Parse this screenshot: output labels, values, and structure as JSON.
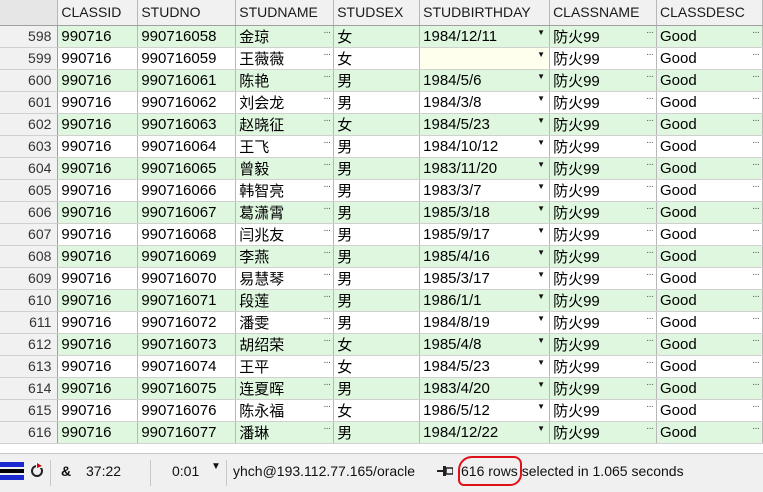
{
  "columns": [
    "CLASSID",
    "STUDNO",
    "STUDNAME",
    "STUDSEX",
    "STUDBIRTHDAY",
    "CLASSNAME",
    "CLASSDESC"
  ],
  "rows": [
    {
      "num": "598",
      "classid": "990716",
      "studno": "990716058",
      "name": "金琼",
      "sex": "女",
      "birthday": "1984/12/11",
      "classname": "防火99",
      "desc": "Good"
    },
    {
      "num": "599",
      "classid": "990716",
      "studno": "990716059",
      "name": "王薇薇",
      "sex": "女",
      "birthday": "",
      "classname": "防火99",
      "desc": "Good"
    },
    {
      "num": "600",
      "classid": "990716",
      "studno": "990716061",
      "name": "陈艳",
      "sex": "男",
      "birthday": "1984/5/6",
      "classname": "防火99",
      "desc": "Good"
    },
    {
      "num": "601",
      "classid": "990716",
      "studno": "990716062",
      "name": "刘会龙",
      "sex": "男",
      "birthday": "1984/3/8",
      "classname": "防火99",
      "desc": "Good"
    },
    {
      "num": "602",
      "classid": "990716",
      "studno": "990716063",
      "name": "赵晓征",
      "sex": "女",
      "birthday": "1984/5/23",
      "classname": "防火99",
      "desc": "Good"
    },
    {
      "num": "603",
      "classid": "990716",
      "studno": "990716064",
      "name": "王飞",
      "sex": "男",
      "birthday": "1984/10/12",
      "classname": "防火99",
      "desc": "Good"
    },
    {
      "num": "604",
      "classid": "990716",
      "studno": "990716065",
      "name": "曾毅",
      "sex": "男",
      "birthday": "1983/11/20",
      "classname": "防火99",
      "desc": "Good"
    },
    {
      "num": "605",
      "classid": "990716",
      "studno": "990716066",
      "name": "韩智亮",
      "sex": "男",
      "birthday": "1983/3/7",
      "classname": "防火99",
      "desc": "Good"
    },
    {
      "num": "606",
      "classid": "990716",
      "studno": "990716067",
      "name": "葛潇霄",
      "sex": "男",
      "birthday": "1985/3/18",
      "classname": "防火99",
      "desc": "Good"
    },
    {
      "num": "607",
      "classid": "990716",
      "studno": "990716068",
      "name": "闫兆友",
      "sex": "男",
      "birthday": "1985/9/17",
      "classname": "防火99",
      "desc": "Good"
    },
    {
      "num": "608",
      "classid": "990716",
      "studno": "990716069",
      "name": "李燕",
      "sex": "男",
      "birthday": "1985/4/16",
      "classname": "防火99",
      "desc": "Good"
    },
    {
      "num": "609",
      "classid": "990716",
      "studno": "990716070",
      "name": "易慧琴",
      "sex": "男",
      "birthday": "1985/3/17",
      "classname": "防火99",
      "desc": "Good"
    },
    {
      "num": "610",
      "classid": "990716",
      "studno": "990716071",
      "name": "段莲",
      "sex": "男",
      "birthday": "1986/1/1",
      "classname": "防火99",
      "desc": "Good"
    },
    {
      "num": "611",
      "classid": "990716",
      "studno": "990716072",
      "name": "潘雯",
      "sex": "男",
      "birthday": "1984/8/19",
      "classname": "防火99",
      "desc": "Good"
    },
    {
      "num": "612",
      "classid": "990716",
      "studno": "990716073",
      "name": "胡绍荣",
      "sex": "女",
      "birthday": "1985/4/8",
      "classname": "防火99",
      "desc": "Good"
    },
    {
      "num": "613",
      "classid": "990716",
      "studno": "990716074",
      "name": "王平",
      "sex": "女",
      "birthday": "1984/5/23",
      "classname": "防火99",
      "desc": "Good"
    },
    {
      "num": "614",
      "classid": "990716",
      "studno": "990716075",
      "name": "连夏晖",
      "sex": "男",
      "birthday": "1983/4/20",
      "classname": "防火99",
      "desc": "Good"
    },
    {
      "num": "615",
      "classid": "990716",
      "studno": "990716076",
      "name": "陈永福",
      "sex": "女",
      "birthday": "1986/5/12",
      "classname": "防火99",
      "desc": "Good"
    },
    {
      "num": "616",
      "classid": "990716",
      "studno": "990716077",
      "name": "潘琳",
      "sex": "男",
      "birthday": "1984/12/22",
      "classname": "防火99",
      "desc": "Good"
    }
  ],
  "status": {
    "flag_icon": "session-flag-icon",
    "refresh_icon": "refresh-stop-icon",
    "amp": "&",
    "cursor_pos": "37:22",
    "elapsed": "0:01",
    "elapsed_dropdown_icon": "triangle-down-icon",
    "connection": "yhch@193.112.77.165/oracle",
    "pin_icon": "pin-icon",
    "rows_count": "616 rows",
    "rows_suffix": " selected in 1.065 seconds",
    "highlight_color": "#e0101a"
  },
  "colors": {
    "row_alt": "#dff7df",
    "row_plain": "#ffffff",
    "header_bg": "#f1f1f1"
  }
}
